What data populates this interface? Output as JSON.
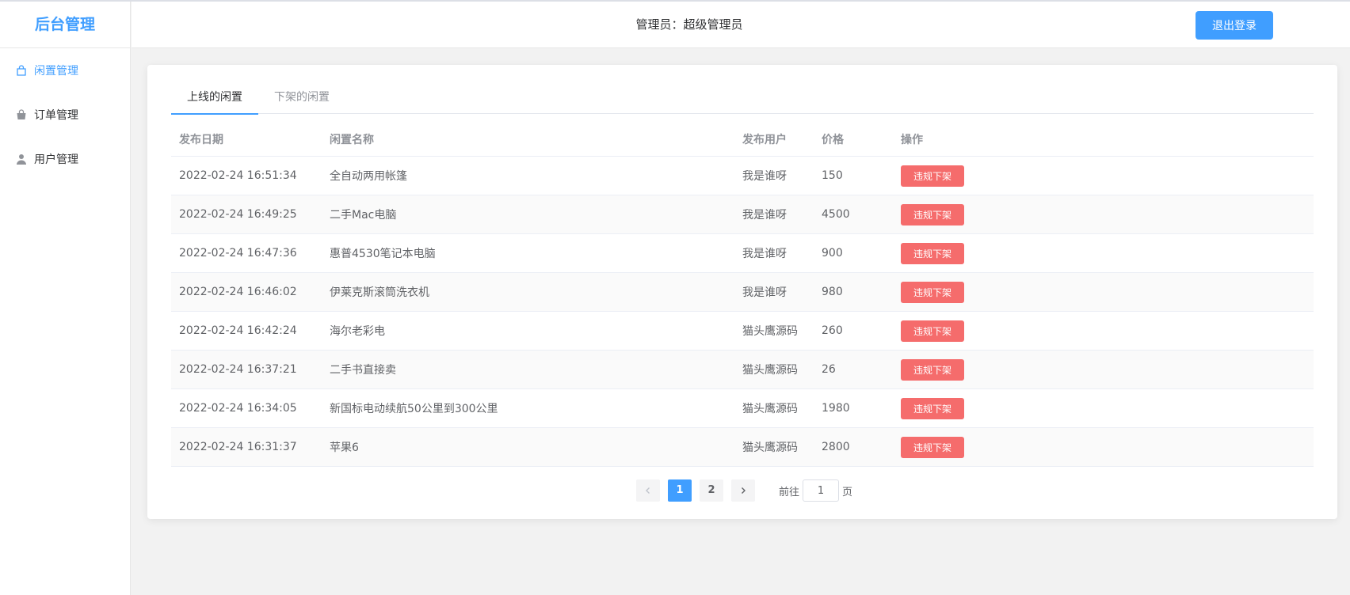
{
  "brand": "后台管理",
  "header": {
    "title": "管理员：超级管理员",
    "logout_label": "退出登录"
  },
  "sidebar": {
    "items": [
      {
        "label": "闲置管理",
        "icon": "shopping-bag-icon"
      },
      {
        "label": "订单管理",
        "icon": "basket-icon"
      },
      {
        "label": "用户管理",
        "icon": "user-icon"
      }
    ]
  },
  "tabs": [
    "上线的闲置",
    "下架的闲置"
  ],
  "table": {
    "headers": {
      "date": "发布日期",
      "name": "闲置名称",
      "user": "发布用户",
      "price": "价格",
      "op": "操作"
    },
    "action_label": "违规下架",
    "rows": [
      {
        "date": "2022-02-24 16:51:34",
        "name": "全自动两用帐篷",
        "user": "我是谁呀",
        "price": "150"
      },
      {
        "date": "2022-02-24 16:49:25",
        "name": "二手Mac电脑",
        "user": "我是谁呀",
        "price": "4500"
      },
      {
        "date": "2022-02-24 16:47:36",
        "name": "惠普4530笔记本电脑",
        "user": "我是谁呀",
        "price": "900"
      },
      {
        "date": "2022-02-24 16:46:02",
        "name": "伊莱克斯滚筒洗衣机",
        "user": "我是谁呀",
        "price": "980"
      },
      {
        "date": "2022-02-24 16:42:24",
        "name": "海尔老彩电",
        "user": "猫头鹰源码",
        "price": "260"
      },
      {
        "date": "2022-02-24 16:37:21",
        "name": "二手书直接卖",
        "user": "猫头鹰源码",
        "price": "26"
      },
      {
        "date": "2022-02-24 16:34:05",
        "name": "新国标电动续航50公里到300公里",
        "user": "猫头鹰源码",
        "price": "1980"
      },
      {
        "date": "2022-02-24 16:31:37",
        "name": "苹果6",
        "user": "猫头鹰源码",
        "price": "2800"
      }
    ]
  },
  "pagination": {
    "pages": [
      "1",
      "2"
    ],
    "current": "1",
    "goto_prefix": "前往",
    "goto_value": "1",
    "goto_suffix": "页"
  },
  "colors": {
    "primary": "#409eff",
    "danger": "#f56c6c"
  }
}
